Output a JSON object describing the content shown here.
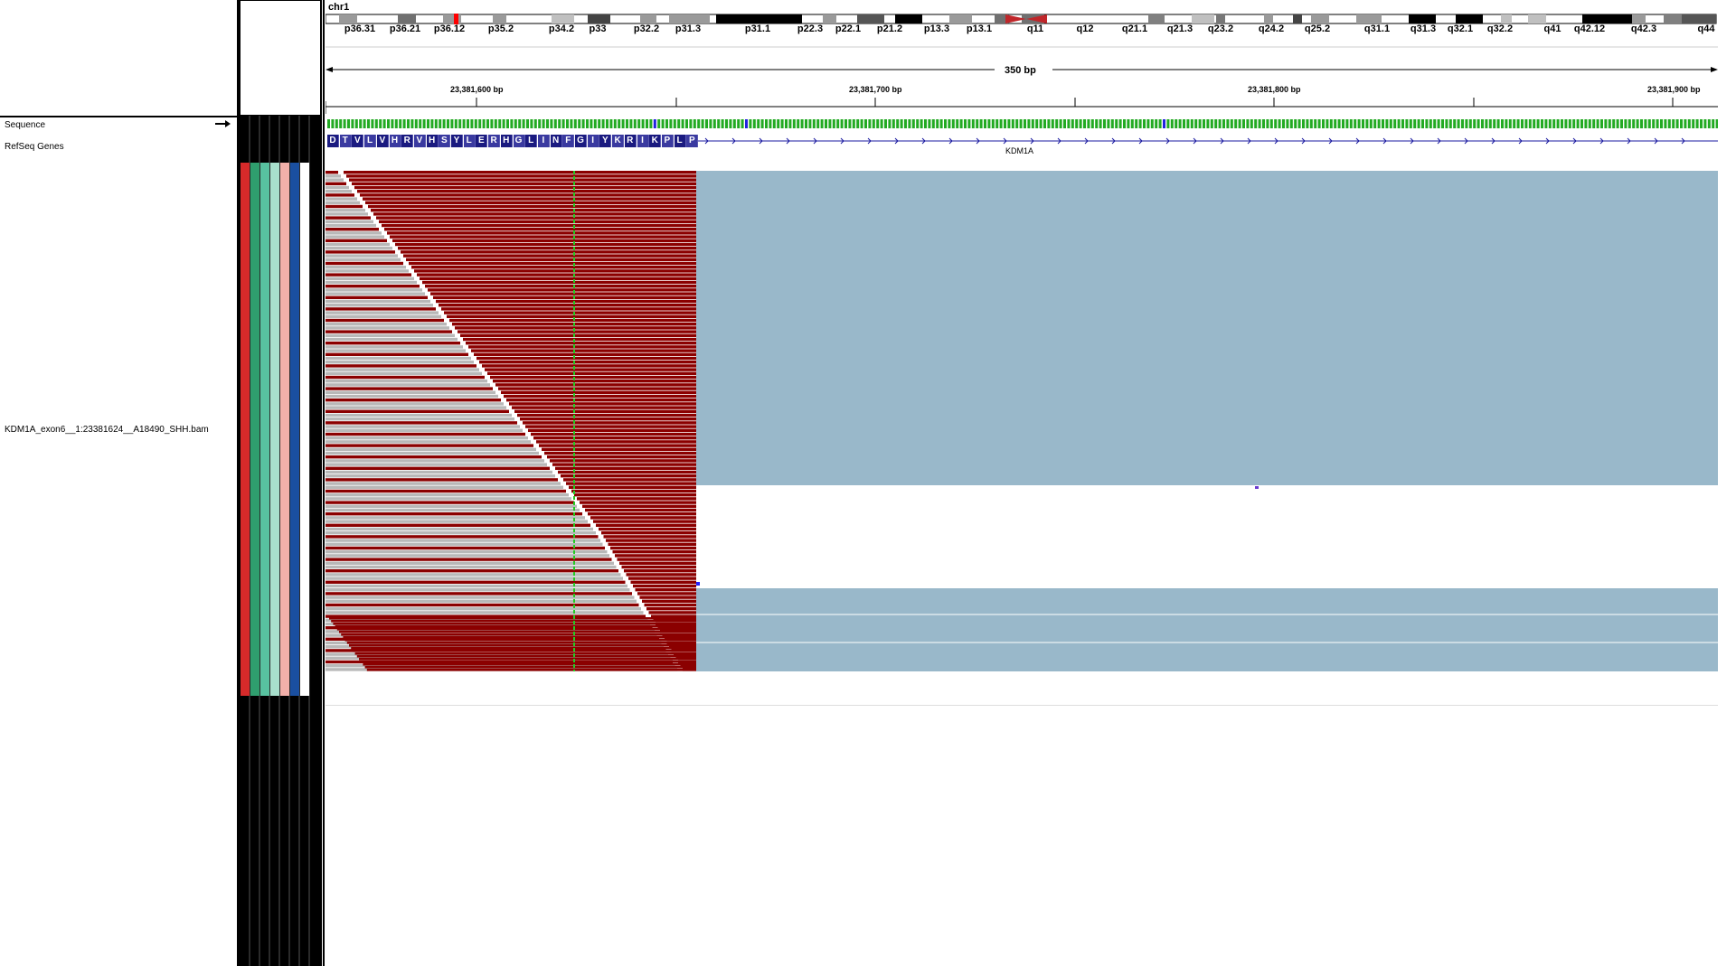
{
  "chromosome": "chr1",
  "cytobands": [
    "p36.31",
    "p36.21",
    "p36.12",
    "p35.2",
    "p34.2",
    "p33",
    "p32.2",
    "p31.3",
    "p31.1",
    "p22.3",
    "p22.1",
    "p21.2",
    "p13.3",
    "p13.1",
    "q11",
    "q12",
    "q21.1",
    "q21.3",
    "q23.2",
    "q24.2",
    "q25.2",
    "q31.1",
    "q31.3",
    "q32.1",
    "q32.2",
    "q41",
    "q42.12",
    "q42.3",
    "q44"
  ],
  "ruler": {
    "span_label": "350 bp",
    "ticks": [
      "23,381,600 bp",
      "23,381,700 bp",
      "23,381,800 bp",
      "23,381,900 bp"
    ]
  },
  "tracks": {
    "sequence": "Sequence",
    "refseq": "RefSeq Genes",
    "bam": "KDM1A_exon6__1:23381624__A18490_SHH.bam"
  },
  "gene": {
    "name": "KDM1A",
    "amino_acids": [
      "D",
      "T",
      "V",
      "L",
      "V",
      "H",
      "R",
      "V",
      "H",
      "S",
      "Y",
      "L",
      "E",
      "R",
      "H",
      "G",
      "L",
      "I",
      "N",
      "F",
      "G",
      "I",
      "Y",
      "K",
      "R",
      "I",
      "K",
      "P",
      "L",
      "P"
    ]
  },
  "colors": {
    "read_red": "#8b0000",
    "read_gray": "#b8b8b8",
    "coverage_blue": "#99b8ca",
    "marker_green": "#22cc22",
    "centromere": "#c0262a",
    "aa_blue": "#1a1a80"
  },
  "icons": {
    "sequence_arrow": "right-arrow-icon"
  }
}
